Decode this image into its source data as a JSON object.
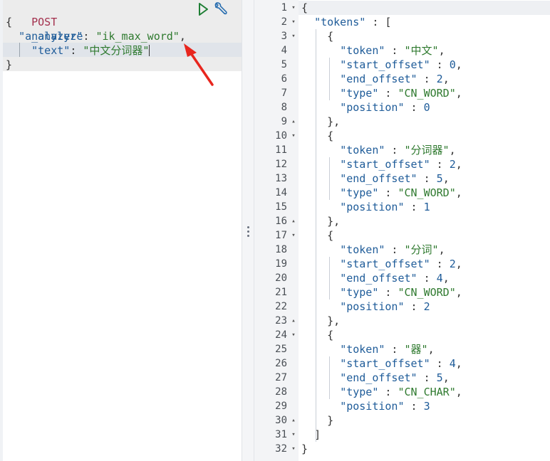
{
  "request": {
    "method": "POST",
    "endpoint": "_analyze",
    "analyzer_key": "\"analyzer\"",
    "analyzer_value": "\"ik_max_word\"",
    "text_key": "\"text\"",
    "text_value": "\"中文分词器\"",
    "open_brace": "{",
    "close_brace": "}",
    "colon": ": ",
    "comma": ","
  },
  "actions": {
    "run_icon": "play-triangle-icon",
    "settings_icon": "wrench-icon"
  },
  "response": {
    "line_numbers": [
      "1",
      "2",
      "3",
      "4",
      "5",
      "6",
      "7",
      "8",
      "9",
      "10",
      "11",
      "12",
      "13",
      "14",
      "15",
      "16",
      "17",
      "18",
      "19",
      "20",
      "21",
      "22",
      "23",
      "24",
      "25",
      "26",
      "27",
      "28",
      "29",
      "30",
      "31",
      "32"
    ],
    "tokens_key": "\"tokens\"",
    "tokens": [
      {
        "token": "\"中文\"",
        "start_offset": "0",
        "end_offset": "2",
        "type": "\"CN_WORD\"",
        "position": "0"
      },
      {
        "token": "\"分词器\"",
        "start_offset": "2",
        "end_offset": "5",
        "type": "\"CN_WORD\"",
        "position": "1"
      },
      {
        "token": "\"分词\"",
        "start_offset": "2",
        "end_offset": "4",
        "type": "\"CN_WORD\"",
        "position": "2"
      },
      {
        "token": "\"器\"",
        "start_offset": "4",
        "end_offset": "5",
        "type": "\"CN_CHAR\"",
        "position": "3"
      }
    ],
    "labels": {
      "token": "\"token\"",
      "start_offset": "\"start_offset\"",
      "end_offset": "\"end_offset\"",
      "type": "\"type\"",
      "position": "\"position\""
    }
  },
  "colors": {
    "method": "#a3304d",
    "key": "#1f5c99",
    "string": "#2f7a2f",
    "arrow": "#e8261e"
  }
}
